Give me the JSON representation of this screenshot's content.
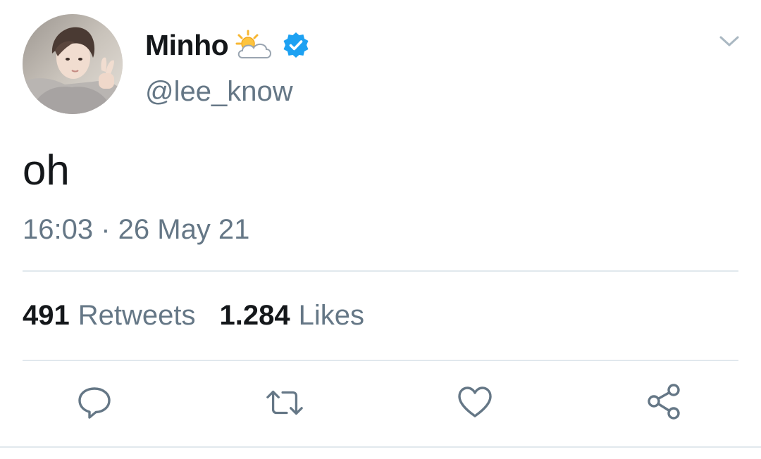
{
  "user": {
    "display_name": "Minho",
    "handle": "@lee_know",
    "name_emoji": "sun-behind-cloud",
    "verified": true
  },
  "tweet": {
    "text": "oh",
    "timestamp": "16:03 · 26 May 21"
  },
  "stats": {
    "retweets_count": "491",
    "retweets_label": "Retweets",
    "likes_count": "1.284",
    "likes_label": "Likes"
  },
  "actions": [
    "reply-icon",
    "retweet-icon",
    "like-icon",
    "share-icon"
  ],
  "colors": {
    "text_primary": "#14171a",
    "text_secondary": "#657786",
    "verified_blue": "#1da1f2",
    "divider": "#e1e8ed"
  }
}
